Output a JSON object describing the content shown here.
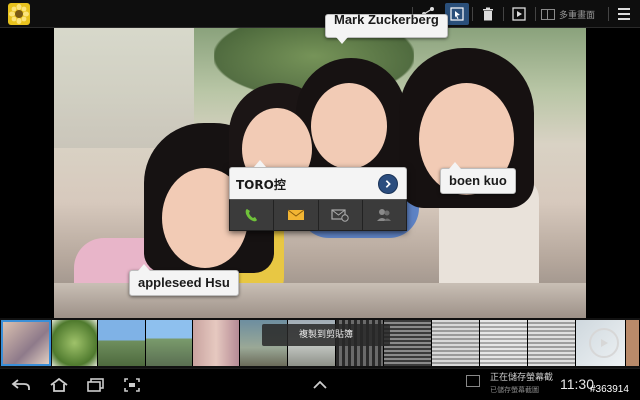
{
  "toolbar": {
    "app_icon": "sunflower-app-icon",
    "share": "share-icon",
    "tag": "tag-icon",
    "delete": "trash-icon",
    "slideshow": "play-icon",
    "multi_window_label": "多重畫面",
    "menu": "overflow-menu-icon"
  },
  "tags": {
    "top": "Mark Zuckerberg",
    "right": "boen kuo",
    "left": "appleseed Hsu"
  },
  "popup": {
    "name": "TORO控",
    "actions": [
      "phone-icon",
      "email-icon",
      "message-icon",
      "contact-group-icon"
    ]
  },
  "filmstrip": {
    "copy_toast": "複製到剪貼簿"
  },
  "statusbar": {
    "saving_text": "正在儲存螢幕截",
    "saved_sub": "已儲存螢幕截圖",
    "time": "11:30"
  },
  "watermark": "#363914"
}
